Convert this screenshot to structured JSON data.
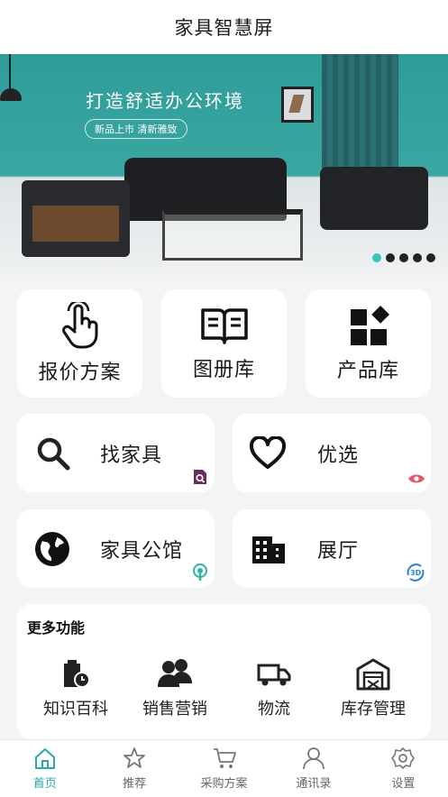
{
  "header": {
    "title": "家具智慧屏"
  },
  "banner": {
    "headline": "打造舒适办公环境",
    "tagline": "新品上市  清新雅致",
    "dots_count": 5,
    "active_dot": 1
  },
  "primary_tiles": [
    {
      "label": "报价方案",
      "icon": "hand-pointer-icon"
    },
    {
      "label": "图册库",
      "icon": "open-book-icon"
    },
    {
      "label": "产品库",
      "icon": "grid-apps-icon"
    }
  ],
  "secondary_tiles": [
    {
      "label": "找家具",
      "icon": "search-icon",
      "badge": "search-doc-badge",
      "badge_color": "#6b2d5c"
    },
    {
      "label": "优选",
      "icon": "heart-icon",
      "badge": "eye-badge",
      "badge_color": "#e05a6a"
    },
    {
      "label": "家具公馆",
      "icon": "globe-icon",
      "badge": "location-badge",
      "badge_color": "#2fb3a7"
    },
    {
      "label": "展厅",
      "icon": "building-icon",
      "badge": "3d-badge",
      "badge_color": "#2f7fd1"
    }
  ],
  "more": {
    "title": "更多功能",
    "items": [
      {
        "label": "知识百科",
        "icon": "knowledge-icon"
      },
      {
        "label": "销售营销",
        "icon": "team-icon"
      },
      {
        "label": "物流",
        "icon": "truck-icon"
      },
      {
        "label": "库存管理",
        "icon": "warehouse-icon"
      }
    ]
  },
  "tabbar": {
    "active": "首页",
    "active_color": "#2ca8a8",
    "items": [
      {
        "label": "首页",
        "icon": "home-icon"
      },
      {
        "label": "推荐",
        "icon": "star-icon"
      },
      {
        "label": "采购方案",
        "icon": "cart-icon"
      },
      {
        "label": "通讯录",
        "icon": "person-icon"
      },
      {
        "label": "设置",
        "icon": "gear-icon"
      }
    ]
  }
}
